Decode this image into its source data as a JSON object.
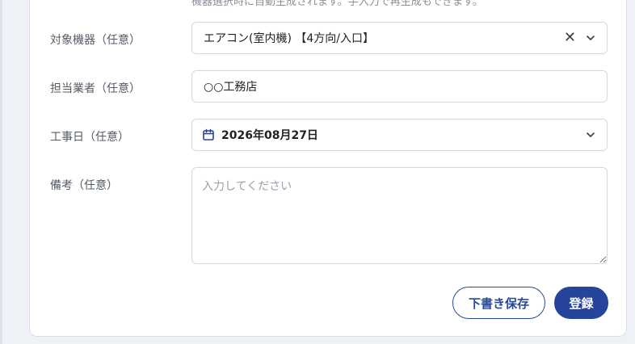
{
  "form": {
    "cut_text": "機器選択時に自動生成されます。手入力で再生成もできます。",
    "device": {
      "label": "対象機器（任意）",
      "value": "エアコン(室内機) 【4方向/入口】"
    },
    "contractor": {
      "label": "担当業者（任意）",
      "value": "○○工務店"
    },
    "work_date": {
      "label": "工事日（任意）",
      "value": "2026年08月27日"
    },
    "notes": {
      "label": "備考（任意）",
      "placeholder": "入力してください"
    }
  },
  "actions": {
    "draft_label": "下書き保存",
    "submit_label": "登録"
  },
  "colors": {
    "accent": "#26449a",
    "border": "#d4d8df",
    "label": "#555b66"
  }
}
